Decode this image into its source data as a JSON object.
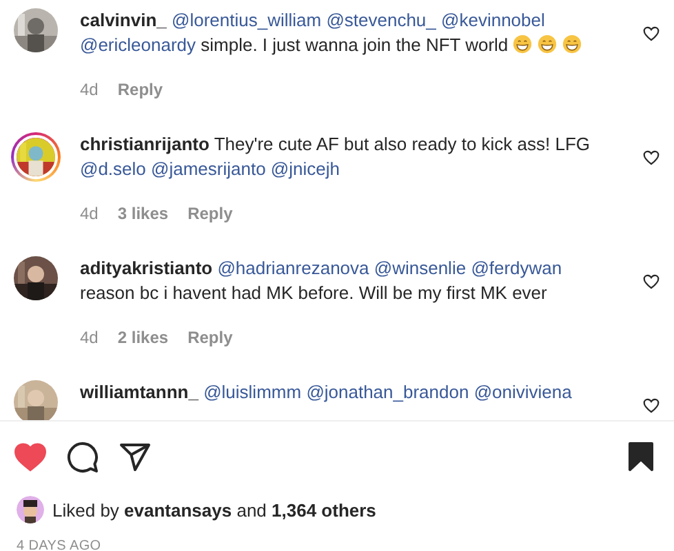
{
  "comments": [
    {
      "user": "calvinvin_",
      "story": false,
      "parts": [
        {
          "kind": "mention",
          "text": "@lorentius_william"
        },
        {
          "kind": "mention",
          "text": "@stevenchu_"
        },
        {
          "kind": "mention",
          "text": "@kevinnobel"
        },
        {
          "kind": "mention",
          "text": "@ericleonardy"
        },
        {
          "kind": "text",
          "text": "simple. I just wanna join the NFT world"
        },
        {
          "kind": "emoji"
        },
        {
          "kind": "emoji"
        },
        {
          "kind": "emoji"
        }
      ],
      "time": "4d",
      "reply": "Reply"
    },
    {
      "user": "christianrijanto",
      "story": true,
      "parts": [
        {
          "kind": "text",
          "text": "They're cute AF but also ready to kick ass! LFG"
        },
        {
          "kind": "mention",
          "text": "@d.selo"
        },
        {
          "kind": "mention",
          "text": "@jamesrijanto"
        },
        {
          "kind": "mention",
          "text": "@jnicejh"
        }
      ],
      "time": "4d",
      "likes": "3 likes",
      "reply": "Reply"
    },
    {
      "user": "adityakristianto",
      "story": false,
      "parts": [
        {
          "kind": "mention",
          "text": "@hadrianrezanova"
        },
        {
          "kind": "mention",
          "text": "@winsenlie"
        },
        {
          "kind": "mention",
          "text": "@ferdywan"
        },
        {
          "kind": "text",
          "text": "reason bc i havent had MK before. Will be my first MK ever"
        }
      ],
      "time": "4d",
      "likes": "2 likes",
      "reply": "Reply"
    },
    {
      "user": "williamtannn_",
      "story": false,
      "parts": [
        {
          "kind": "mention",
          "text": "@luislimmm"
        },
        {
          "kind": "mention",
          "text": "@jonathan_brandon"
        },
        {
          "kind": "mention",
          "text": "@oniviviena"
        }
      ]
    }
  ],
  "actions": {
    "liked": true,
    "saved": true
  },
  "liked_by": {
    "prefix": "Liked by",
    "user": "evantansays",
    "middle": "and",
    "others": "1,364 others"
  },
  "date": "4 DAYS AGO"
}
